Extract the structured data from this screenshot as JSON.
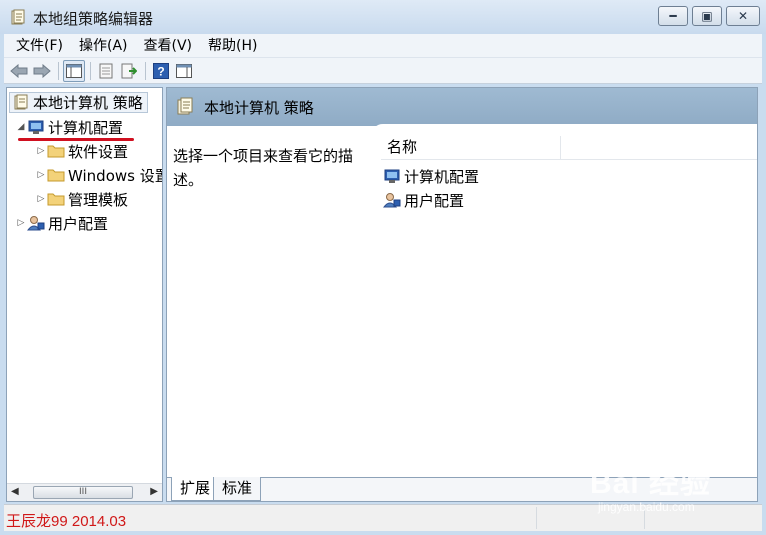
{
  "window": {
    "title": "本地组策略编辑器",
    "buttons": {
      "minimize": "━",
      "maximize": "▣",
      "close": "✕"
    }
  },
  "menu": [
    "文件(F)",
    "操作(A)",
    "查看(V)",
    "帮助(H)"
  ],
  "toolbar": {
    "icons": [
      "back-arrow-icon",
      "forward-arrow-icon",
      "show-hide-tree-icon",
      "properties-icon",
      "export-list-icon",
      "help-icon",
      "show-hide-action-pane-icon"
    ]
  },
  "tree": {
    "root": "本地计算机 策略",
    "items": [
      {
        "label": "计算机配置",
        "expanded": true
      },
      {
        "label": "软件设置",
        "expanded": false
      },
      {
        "label": "Windows 设置",
        "expanded": false
      },
      {
        "label": "管理模板",
        "expanded": false
      },
      {
        "label": "用户配置",
        "expanded": false
      }
    ]
  },
  "scrollbar": {
    "thumb_grip": "III"
  },
  "right": {
    "header": "本地计算机 策略",
    "description": "选择一个项目来查看它的描述。",
    "column_name": "名称",
    "rows": [
      "计算机配置",
      "用户配置"
    ],
    "tabs": [
      "扩展",
      "标准"
    ]
  },
  "status": {
    "text": "王辰龙99 2014.03"
  },
  "watermark": {
    "logo": "Bai 经验",
    "sub": "jingyan.baidu.com"
  },
  "colors": {
    "accent_red": "#d01020",
    "header_blue": "#9fbad2",
    "frame": "#c9dcef"
  }
}
